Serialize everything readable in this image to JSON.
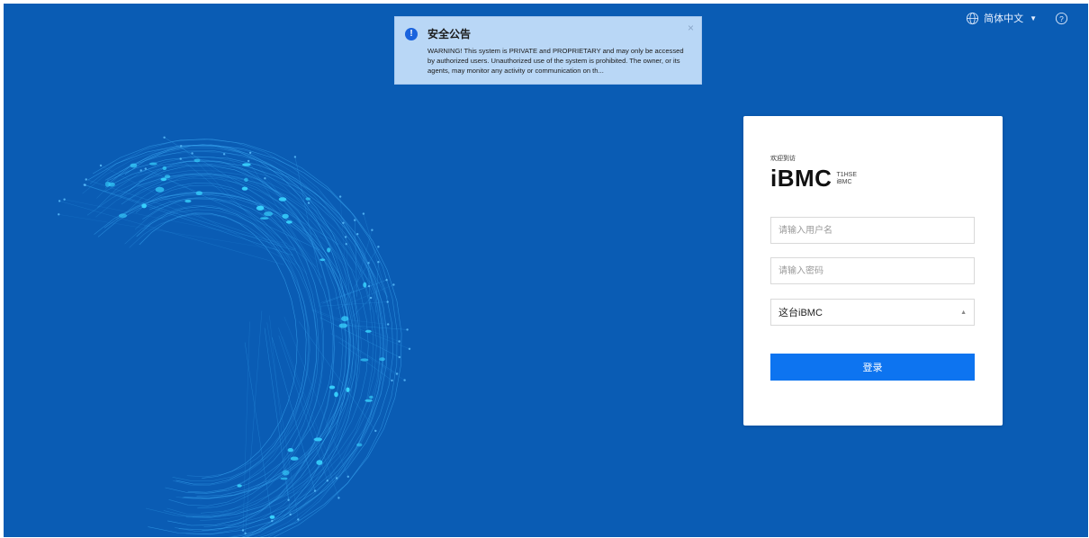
{
  "colors": {
    "background": "#0a5cb4",
    "primary_button": "#0d74f0",
    "notice_bg": "#b9d7f6",
    "info_icon": "#1a63dd"
  },
  "topbar": {
    "language": "简体中文",
    "language_icon": "globe-icon",
    "help_icon": "help-circle-icon"
  },
  "notice": {
    "title": "安全公告",
    "text": "WARNING! This system is PRIVATE and PROPRIETARY and may only be accessed by authorized users. Unauthorized use of the system is prohibited. The owner, or its agents, may monitor any activity or communication on th...",
    "info_icon": "info-icon",
    "close_icon": "close-icon"
  },
  "login": {
    "welcome": "欢迎到访",
    "logo": "iBMC",
    "logo_sub_1": "T1HSE",
    "logo_sub_2": "iBMC",
    "username_placeholder": "请输入用户名",
    "password_placeholder": "请输入密码",
    "domain_value": "这台iBMC",
    "login_label": "登录"
  }
}
